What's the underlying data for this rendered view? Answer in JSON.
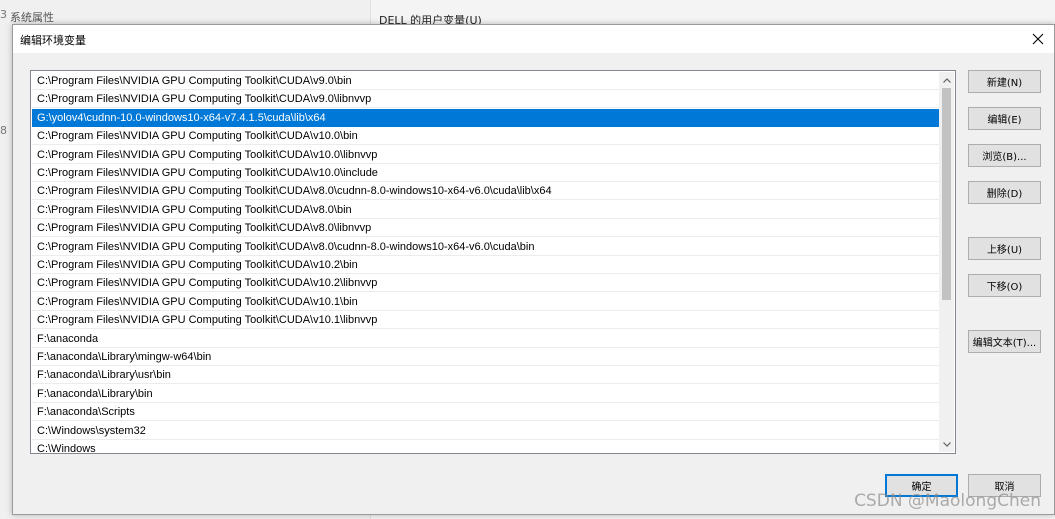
{
  "background": {
    "left_window_title": "系统属性",
    "left_edge_glyph": "3",
    "left_edge_glyph2": "8",
    "right_panel_label": "DELL 的用户变量(U)"
  },
  "dialog": {
    "title": "编辑环境变量",
    "close_icon": "close-icon",
    "list": {
      "selected_index": 2,
      "items": [
        "C:\\Program Files\\NVIDIA GPU Computing Toolkit\\CUDA\\v9.0\\bin",
        "C:\\Program Files\\NVIDIA GPU Computing Toolkit\\CUDA\\v9.0\\libnvvp",
        "G:\\yolov4\\cudnn-10.0-windows10-x64-v7.4.1.5\\cuda\\lib\\x64",
        "C:\\Program Files\\NVIDIA GPU Computing Toolkit\\CUDA\\v10.0\\bin",
        "C:\\Program Files\\NVIDIA GPU Computing Toolkit\\CUDA\\v10.0\\libnvvp",
        "C:\\Program Files\\NVIDIA GPU Computing Toolkit\\CUDA\\v10.0\\include",
        "C:\\Program Files\\NVIDIA GPU Computing Toolkit\\CUDA\\v8.0\\cudnn-8.0-windows10-x64-v6.0\\cuda\\lib\\x64",
        "C:\\Program Files\\NVIDIA GPU Computing Toolkit\\CUDA\\v8.0\\bin",
        "C:\\Program Files\\NVIDIA GPU Computing Toolkit\\CUDA\\v8.0\\libnvvp",
        "C:\\Program Files\\NVIDIA GPU Computing Toolkit\\CUDA\\v8.0\\cudnn-8.0-windows10-x64-v6.0\\cuda\\bin",
        "C:\\Program Files\\NVIDIA GPU Computing Toolkit\\CUDA\\v10.2\\bin",
        "C:\\Program Files\\NVIDIA GPU Computing Toolkit\\CUDA\\v10.2\\libnvvp",
        "C:\\Program Files\\NVIDIA GPU Computing Toolkit\\CUDA\\v10.1\\bin",
        "C:\\Program Files\\NVIDIA GPU Computing Toolkit\\CUDA\\v10.1\\libnvvp",
        "F:\\anaconda",
        "F:\\anaconda\\Library\\mingw-w64\\bin",
        "F:\\anaconda\\Library\\usr\\bin",
        "F:\\anaconda\\Library\\bin",
        "F:\\anaconda\\Scripts",
        "C:\\Windows\\system32",
        "C:\\Windows"
      ]
    },
    "buttons": {
      "new": "新建(N)",
      "edit": "编辑(E)",
      "browse": "浏览(B)...",
      "delete": "删除(D)",
      "move_up": "上移(U)",
      "move_down": "下移(O)",
      "edit_text": "编辑文本(T)...",
      "ok": "确定",
      "cancel": "取消"
    },
    "colors": {
      "selection": "#0078d7",
      "primary_border": "#0078d7"
    }
  },
  "watermark": "CSDN @MaolongChen"
}
